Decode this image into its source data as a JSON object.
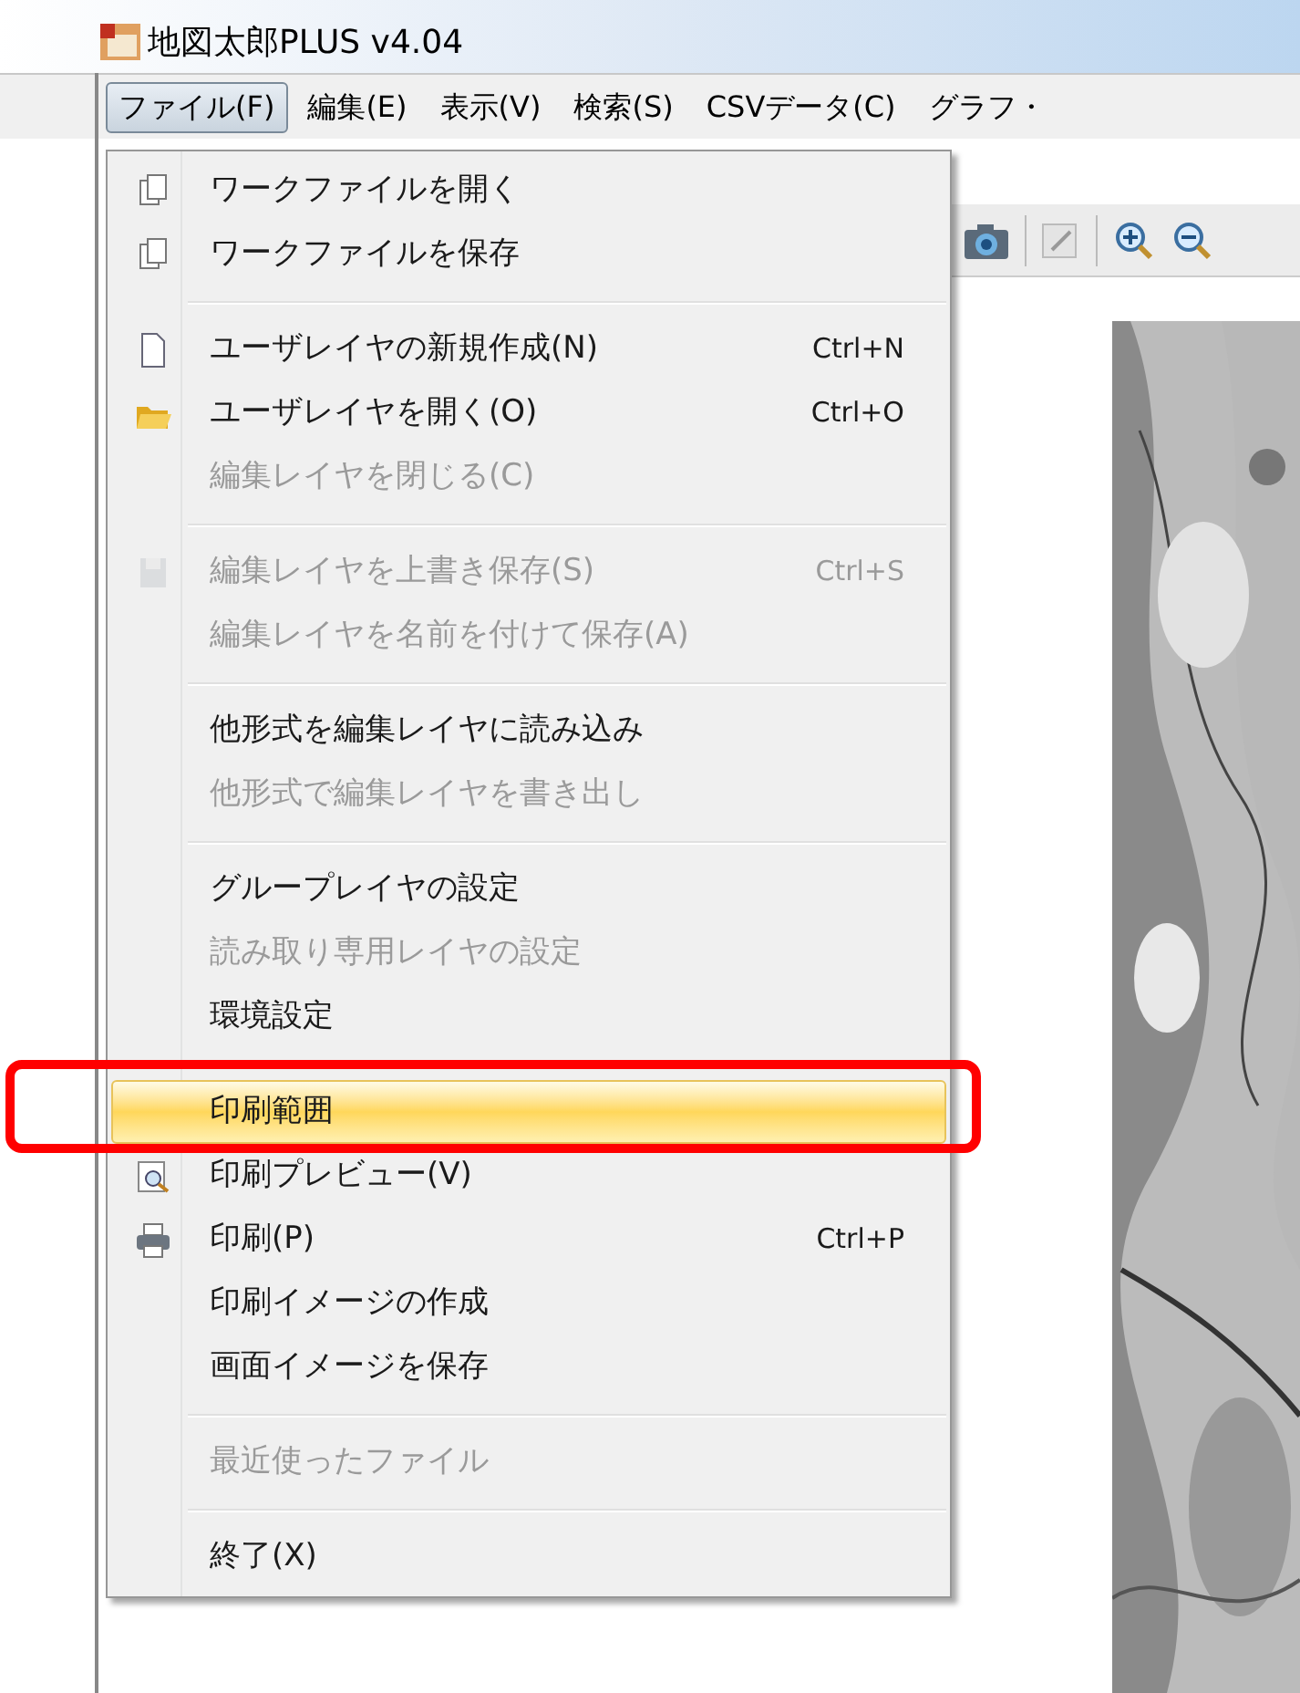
{
  "window": {
    "title": "地図太郎PLUS v4.04"
  },
  "menubar": [
    {
      "label": "ファイル(F)",
      "selected": true
    },
    {
      "label": "編集(E)",
      "selected": false
    },
    {
      "label": "表示(V)",
      "selected": false
    },
    {
      "label": "検索(S)",
      "selected": false
    },
    {
      "label": "CSVデータ(C)",
      "selected": false
    },
    {
      "label": "グラフ・",
      "selected": false
    }
  ],
  "file_menu": [
    {
      "kind": "item",
      "label": "ワークファイルを開く",
      "disabled": false,
      "selected": false
    },
    {
      "kind": "item",
      "label": "ワークファイルを保存",
      "disabled": false,
      "selected": false
    },
    {
      "kind": "separator"
    },
    {
      "kind": "item",
      "label": "ユーザレイヤの新規作成(N)",
      "shortcut": "Ctrl+N",
      "disabled": false,
      "selected": false
    },
    {
      "kind": "item",
      "label": "ユーザレイヤを開く(O)",
      "shortcut": "Ctrl+O",
      "disabled": false,
      "selected": false
    },
    {
      "kind": "item",
      "label": "編集レイヤを閉じる(C)",
      "disabled": true,
      "selected": false
    },
    {
      "kind": "separator"
    },
    {
      "kind": "item",
      "label": "編集レイヤを上書き保存(S)",
      "shortcut": "Ctrl+S",
      "disabled": true,
      "selected": false
    },
    {
      "kind": "item",
      "label": "編集レイヤを名前を付けて保存(A)",
      "disabled": true,
      "selected": false
    },
    {
      "kind": "separator"
    },
    {
      "kind": "item",
      "label": "他形式を編集レイヤに読み込み",
      "disabled": false,
      "selected": false
    },
    {
      "kind": "item",
      "label": "他形式で編集レイヤを書き出し",
      "disabled": true,
      "selected": false
    },
    {
      "kind": "separator"
    },
    {
      "kind": "item",
      "label": "グループレイヤの設定",
      "disabled": false,
      "selected": false
    },
    {
      "kind": "item",
      "label": "読み取り専用レイヤの設定",
      "disabled": true,
      "selected": false
    },
    {
      "kind": "item",
      "label": "環境設定",
      "disabled": false,
      "selected": false
    },
    {
      "kind": "separator"
    },
    {
      "kind": "item",
      "label": "印刷範囲",
      "disabled": false,
      "selected": true
    },
    {
      "kind": "item",
      "label": "印刷プレビュー(V)",
      "disabled": false,
      "selected": false
    },
    {
      "kind": "item",
      "label": "印刷(P)",
      "shortcut": "Ctrl+P",
      "disabled": false,
      "selected": false
    },
    {
      "kind": "item",
      "label": "印刷イメージの作成",
      "disabled": false,
      "selected": false
    },
    {
      "kind": "item",
      "label": "画面イメージを保存",
      "disabled": false,
      "selected": false
    },
    {
      "kind": "separator"
    },
    {
      "kind": "item",
      "label": "最近使ったファイル",
      "disabled": true,
      "selected": false
    },
    {
      "kind": "separator"
    },
    {
      "kind": "item",
      "label": "終了(X)",
      "disabled": false,
      "selected": false
    }
  ]
}
